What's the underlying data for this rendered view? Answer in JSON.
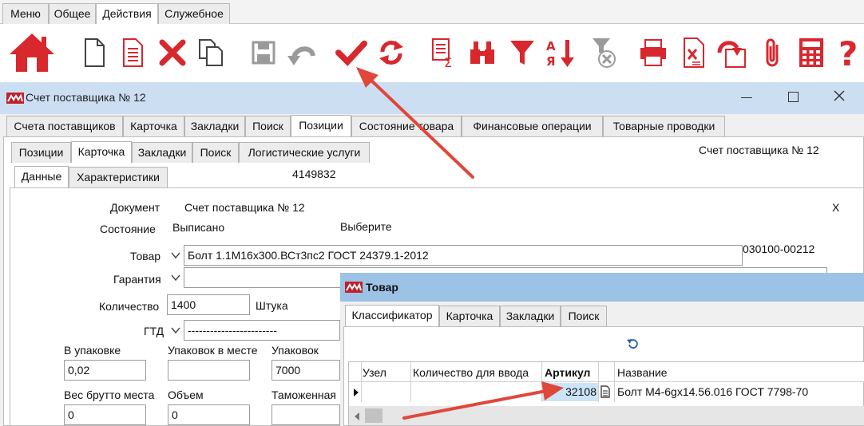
{
  "menu_tabs": [
    {
      "label": "Меню"
    },
    {
      "label": "Общее"
    },
    {
      "label": "Действия"
    },
    {
      "label": "Служебное"
    }
  ],
  "window": {
    "title": "Счет поставщика № 12",
    "tabs": [
      "Счета поставщиков",
      "Карточка",
      "Закладки",
      "Поиск",
      "Позиции",
      "Состояние товара",
      "Финансовые операции",
      "Товарные проводки"
    ],
    "subtabs": [
      "Позиции",
      "Карточка",
      "Закладки",
      "Поиск",
      "Логистические услуги"
    ],
    "subsubtabs": [
      "Данные",
      "Характеристики"
    ],
    "header_doc": "Счет поставщика № 12",
    "doc_number": "4149832"
  },
  "form": {
    "doc_label": "Документ",
    "doc_value": "Счет поставщика № 12",
    "close_x": "X",
    "state_label": "Состояние",
    "state_value": "Выписано",
    "choose": "Выберите",
    "product_label": "Товар",
    "product_value": "Болт 1.1М16х300.ВСт3пс2 ГОСТ 24379.1-2012",
    "product_code": "030100-00212",
    "warranty_label": "Гарантия",
    "warranty_value": "",
    "qty_label": "Количество",
    "qty_value": "1400",
    "unit": "Штука",
    "gtd_label": "ГТД",
    "gtd_value": "------------------------",
    "in_pack_label": "В упаковке",
    "in_pack_value": "0,02",
    "packs_in_place_label": "Упаковок в месте",
    "packs_in_place_value": "",
    "packs_label": "Упаковок",
    "packs_value": "7000",
    "gross_label": "Вес брутто места",
    "gross_value": "0",
    "volume_label": "Объем",
    "volume_value": "0",
    "customs_label": "Таможенная",
    "customs_value": ""
  },
  "popup": {
    "title": "Товар",
    "tabs": [
      "Классификатор",
      "Карточка",
      "Закладки",
      "Поиск"
    ],
    "columns": [
      "Узел",
      "Количество для ввода",
      "Артикул",
      "Название"
    ],
    "row": {
      "node": "",
      "qty": "",
      "article": "32108",
      "name": "Болт М4-6gх14.56.016 ГОСТ 7798-70"
    }
  },
  "colors": {
    "icon_red": "#d9272e",
    "icon_gray": "#9a9a9a",
    "title_bar": "#ccdff2",
    "popup_title": "#9cc3e6",
    "selection": "#cce4f7",
    "arrow": "#e0473b"
  }
}
